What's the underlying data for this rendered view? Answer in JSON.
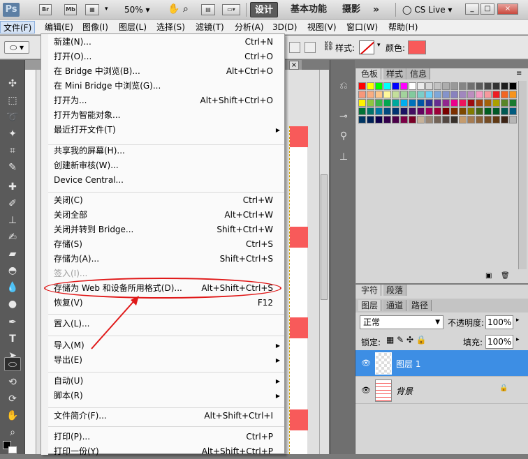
{
  "app": {
    "logo": "Ps",
    "zoom": "50%",
    "icons": [
      "Br",
      "Mb"
    ]
  },
  "workspace": {
    "active": "设计",
    "basic": "基本功能",
    "photo": "摄影",
    "more": "»"
  },
  "cs_live": "CS Live",
  "window_buttons": [
    "_",
    "□",
    "×"
  ],
  "menubar": [
    "文件(F)",
    "编辑(E)",
    "图像(I)",
    "图层(L)",
    "选择(S)",
    "滤镜(T)",
    "分析(A)",
    "3D(D)",
    "视图(V)",
    "窗口(W)",
    "帮助(H)"
  ],
  "options": {
    "style_label": "样式:",
    "color_label": "颜色:",
    "color_value": "#f85a5a"
  },
  "file_menu": [
    {
      "label": "新建(N)...",
      "shortcut": "Ctrl+N"
    },
    {
      "label": "打开(O)...",
      "shortcut": "Ctrl+O"
    },
    {
      "label": "在 Bridge 中浏览(B)...",
      "shortcut": "Alt+Ctrl+O"
    },
    {
      "label": "在 Mini Bridge 中浏览(G)...",
      "shortcut": ""
    },
    {
      "label": "打开为...",
      "shortcut": "Alt+Shift+Ctrl+O"
    },
    {
      "label": "打开为智能对象...",
      "shortcut": ""
    },
    {
      "label": "最近打开文件(T)",
      "shortcut": ""
    },
    {
      "label": "共享我的屏幕(H)...",
      "shortcut": ""
    },
    {
      "label": "创建新审核(W)...",
      "shortcut": ""
    },
    {
      "label": "Device Central...",
      "shortcut": ""
    },
    {
      "label": "关闭(C)",
      "shortcut": "Ctrl+W"
    },
    {
      "label": "关闭全部",
      "shortcut": "Alt+Ctrl+W"
    },
    {
      "label": "关闭并转到 Bridge...",
      "shortcut": "Shift+Ctrl+W"
    },
    {
      "label": "存储(S)",
      "shortcut": "Ctrl+S"
    },
    {
      "label": "存储为(A)...",
      "shortcut": "Shift+Ctrl+S"
    },
    {
      "label": "签入(I)...",
      "shortcut": ""
    },
    {
      "label": "存储为 Web 和设备所用格式(D)...",
      "shortcut": "Alt+Shift+Ctrl+S"
    },
    {
      "label": "恢复(V)",
      "shortcut": "F12"
    },
    {
      "label": "置入(L)...",
      "shortcut": ""
    },
    {
      "label": "导入(M)",
      "shortcut": ""
    },
    {
      "label": "导出(E)",
      "shortcut": ""
    },
    {
      "label": "自动(U)",
      "shortcut": ""
    },
    {
      "label": "脚本(R)",
      "shortcut": ""
    },
    {
      "label": "文件简介(F)...",
      "shortcut": "Alt+Shift+Ctrl+I"
    },
    {
      "label": "打印(P)...",
      "shortcut": "Ctrl+P"
    },
    {
      "label": "打印一份(Y)",
      "shortcut": "Alt+Shift+Ctrl+P"
    }
  ],
  "swatches_panel": {
    "tabs": [
      "色板",
      "样式",
      "信息"
    ]
  },
  "layers_panel": {
    "top_tabs": [
      "字符",
      "段落"
    ],
    "tabs": [
      "图层",
      "通道",
      "路径"
    ],
    "blend_mode": "正常",
    "opacity_label": "不透明度:",
    "opacity": "100%",
    "lock_label": "锁定:",
    "fill_label": "填充:",
    "fill": "100%",
    "layers": [
      {
        "name": "图层 1",
        "selected": true
      },
      {
        "name": "背景",
        "selected": false
      }
    ]
  }
}
